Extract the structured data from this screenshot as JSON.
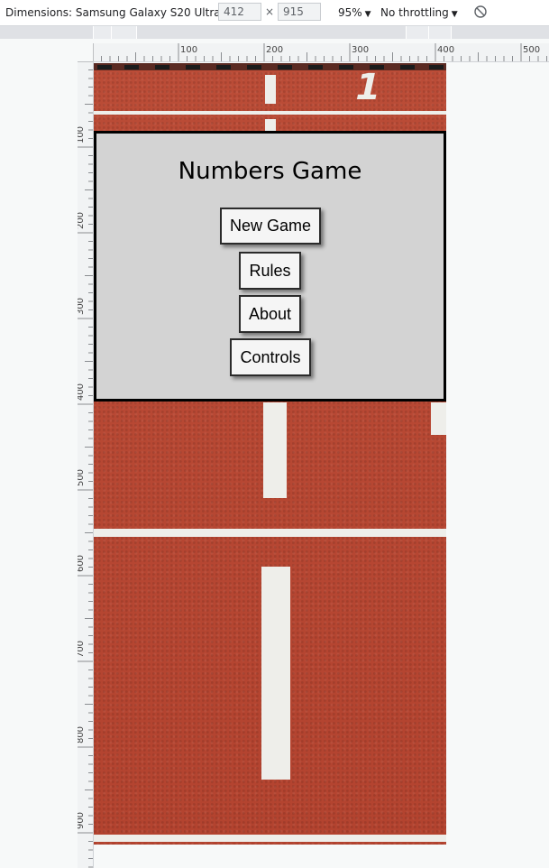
{
  "devtools": {
    "dimensions_label": "Dimensions: Samsung Galaxy S20 Ultra",
    "width_value": "412",
    "times_symbol": "×",
    "height_value": "915",
    "zoom": "95%",
    "throttling": "No throttling",
    "rotate_icon": "rotate-icon"
  },
  "ruler": {
    "horizontal": [
      "100",
      "200",
      "300",
      "400",
      "500"
    ],
    "vertical": [
      "100",
      "200",
      "300",
      "400",
      "500",
      "600",
      "700",
      "800",
      "900"
    ]
  },
  "lane_number": "1",
  "menu": {
    "title": "Numbers Game",
    "buttons": [
      "New Game",
      "Rules",
      "About",
      "Controls"
    ]
  },
  "colors": {
    "track": "#b84a36",
    "panel": "#d3d3d3",
    "button": "#f5f5f5"
  }
}
